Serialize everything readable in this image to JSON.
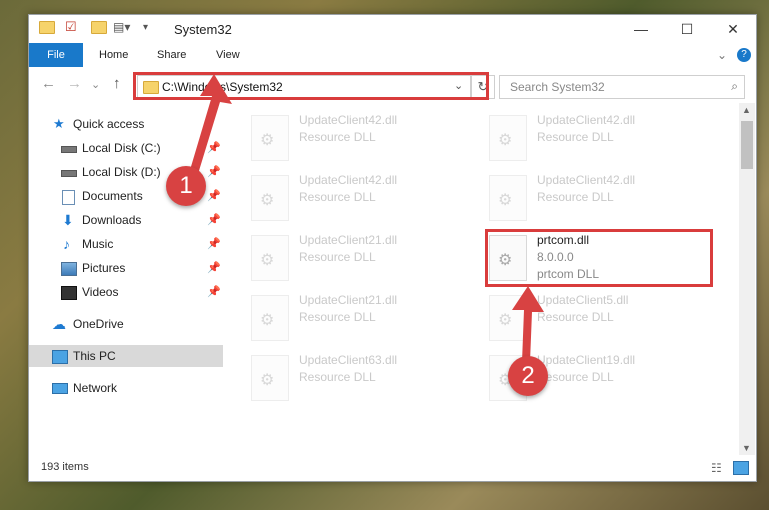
{
  "window": {
    "title": "System32",
    "minimize_glyph": "—",
    "maximize_glyph": "☐",
    "close_glyph": "✕"
  },
  "ribbon": {
    "tabs": [
      "File",
      "Home",
      "Share",
      "View"
    ],
    "expand_glyph": "⌄",
    "help_glyph": "?"
  },
  "nav": {
    "back_glyph": "←",
    "forward_glyph": "→",
    "recent_glyph": "⌄",
    "up_glyph": "↑",
    "address": "C:\\Windows\\System32",
    "dropdown_glyph": "⌄",
    "refresh_glyph": "↻",
    "search_placeholder": "Search System32",
    "search_glyph": "⌕"
  },
  "sidebar": {
    "items": [
      {
        "label": "Quick access",
        "icon": "star-icon",
        "pinned": false
      },
      {
        "label": "Local Disk (C:)",
        "icon": "drive-icon",
        "pinned": true
      },
      {
        "label": "Local Disk (D:)",
        "icon": "drive-icon",
        "pinned": true
      },
      {
        "label": "Documents",
        "icon": "documents-icon",
        "pinned": true
      },
      {
        "label": "Downloads",
        "icon": "download-icon",
        "pinned": true
      },
      {
        "label": "Music",
        "icon": "music-icon",
        "pinned": true
      },
      {
        "label": "Pictures",
        "icon": "pictures-icon",
        "pinned": true
      },
      {
        "label": "Videos",
        "icon": "video-icon",
        "pinned": true
      },
      {
        "label": "OneDrive",
        "icon": "cloud-icon",
        "pinned": false
      },
      {
        "label": "This PC",
        "icon": "computer-icon",
        "pinned": false
      },
      {
        "label": "Network",
        "icon": "network-icon",
        "pinned": false
      }
    ],
    "pin_glyph": "📌"
  },
  "files": [
    {
      "name": "UpdateClient42.dll",
      "type": "Resource DLL"
    },
    {
      "name": "UpdateClient42.dll",
      "type": "Resource DLL"
    },
    {
      "name": "UpdateClient42.dll",
      "type": "Resource DLL"
    },
    {
      "name": "UpdateClient42.dll",
      "type": "Resource DLL"
    },
    {
      "name": "UpdateClient21.dll",
      "type": "Resource DLL"
    },
    {
      "name": "prtcom.dll",
      "version": "8.0.0.0",
      "type": "prtcom DLL",
      "highlighted": true
    },
    {
      "name": "UpdateClient21.dll",
      "type": "Resource DLL"
    },
    {
      "name": "UpdateClient5.dll",
      "type": "Resource DLL"
    },
    {
      "name": "UpdateClient63.dll",
      "type": "Resource DLL"
    },
    {
      "name": "UpdateClient19.dll",
      "type": "Resource DLL"
    }
  ],
  "status": {
    "item_count": "193 items"
  },
  "annotations": {
    "marker1": "1",
    "marker2": "2",
    "highlight_color": "#d93c3c"
  }
}
